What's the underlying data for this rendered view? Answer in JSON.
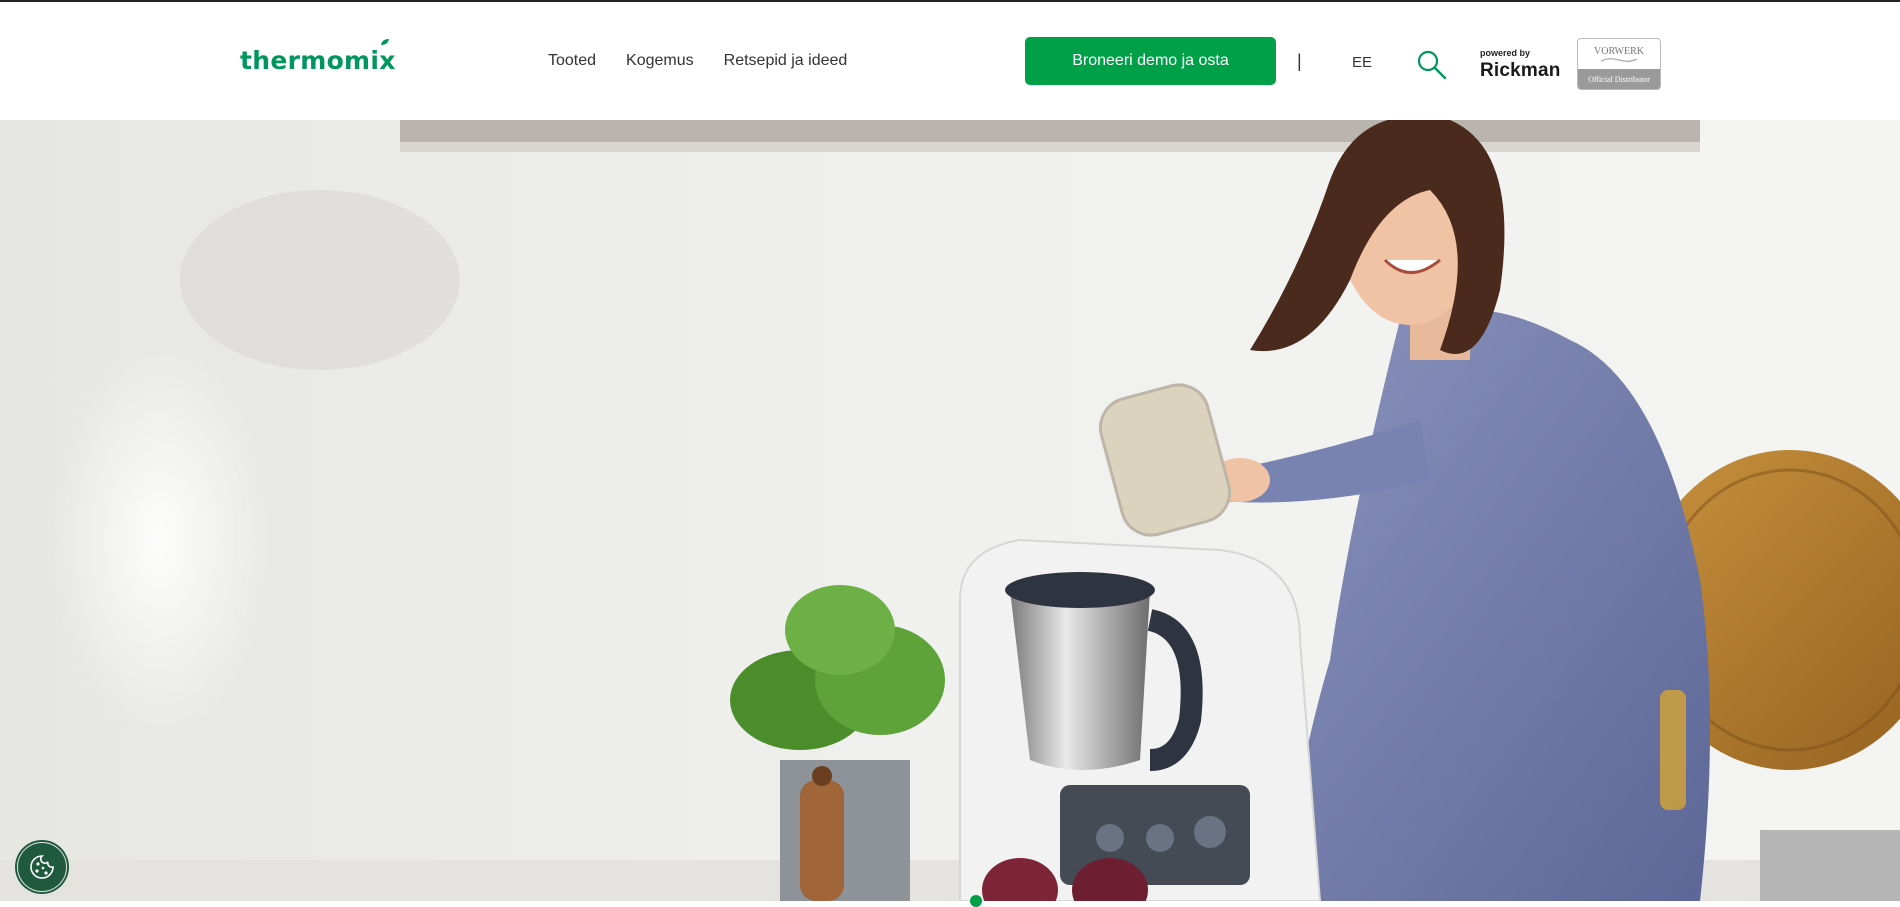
{
  "header": {
    "logo_text": "thermomix",
    "nav": [
      {
        "label": "Tooted"
      },
      {
        "label": "Kogemus"
      },
      {
        "label": "Retsepid ja ideed"
      }
    ],
    "cta_label": "Broneeri demo ja osta",
    "divider": "|",
    "language": "EE",
    "powered_by": "powered by",
    "partner_brand": "Rickman",
    "vorwerk_name": "VORWERK",
    "vorwerk_tagline": "Official Distributor"
  },
  "hero": {
    "image_subject": "woman-with-thermomix-kitchen",
    "active_slide": 1
  },
  "cookie": {
    "icon": "cookie-icon"
  },
  "colors": {
    "brand_green": "#00965e",
    "button_green": "#00a048",
    "cookie_green": "#1f5a3e",
    "text_dark": "#333333"
  },
  "icons": [
    "search-icon",
    "cookie-icon",
    "leaf-icon"
  ]
}
